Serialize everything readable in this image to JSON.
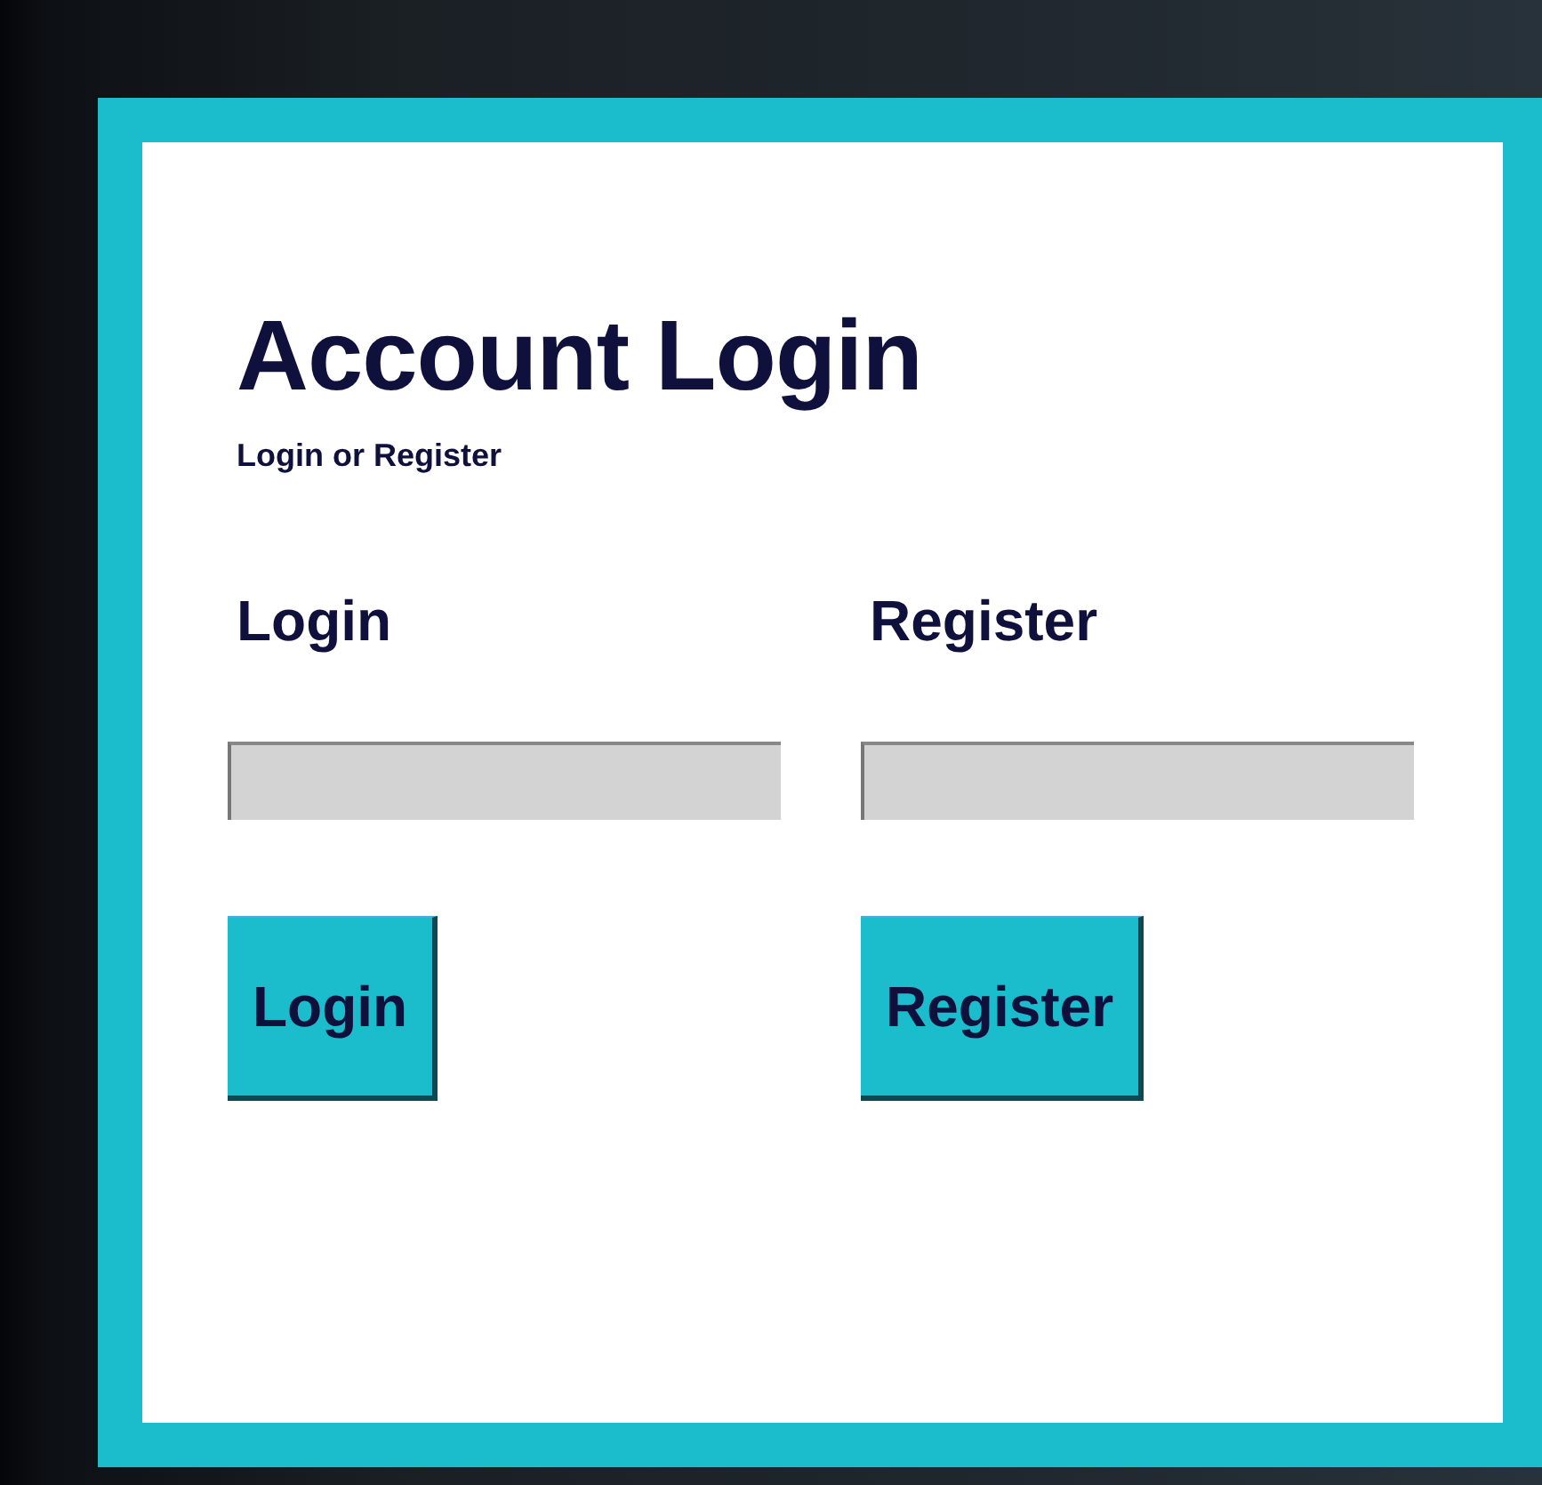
{
  "title": "Account Login",
  "subtitle": "Login or Register",
  "columns": [
    {
      "heading": "Login",
      "button": "Login"
    },
    {
      "heading": "Register",
      "button": "Register"
    }
  ]
}
